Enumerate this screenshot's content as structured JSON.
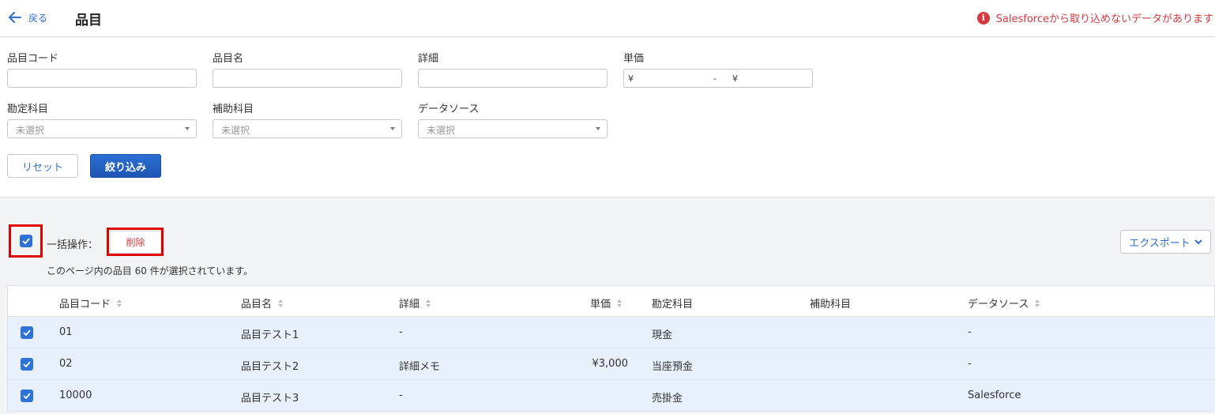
{
  "header": {
    "back_label": "戻る",
    "title": "品目",
    "warning": "Salesforceから取り込めないデータがあります"
  },
  "filters": {
    "code_label": "品目コード",
    "name_label": "品目名",
    "detail_label": "詳細",
    "price_label": "単価",
    "price_from_symbol": "¥",
    "price_separator": "-",
    "price_to_symbol": "¥",
    "account_label": "勘定科目",
    "sub_account_label": "補助科目",
    "source_label": "データソース",
    "account_value": "未選択",
    "sub_account_value": "未選択",
    "source_value": "未選択",
    "reset_label": "リセット",
    "apply_label": "絞り込み"
  },
  "bulk": {
    "label": "一括操作：",
    "delete_label": "削除",
    "export_label": "エクスポート",
    "selected_message": "このページ内の品目 60 件が選択されています。"
  },
  "table": {
    "columns": [
      "品目コード",
      "品目名",
      "詳細",
      "単価",
      "勘定科目",
      "補助科目",
      "データソース"
    ],
    "rows": [
      {
        "code": "01",
        "name": "品目テスト1",
        "detail": "-",
        "price": "",
        "account": "現金",
        "sub_account": "",
        "source": "-"
      },
      {
        "code": "02",
        "name": "品目テスト2",
        "detail": "詳細メモ",
        "price": "¥3,000",
        "account": "当座預金",
        "sub_account": "",
        "source": "-"
      },
      {
        "code": "10000",
        "name": "品目テスト3",
        "detail": "-",
        "price": "",
        "account": "売掛金",
        "sub_account": "",
        "source": "Salesforce"
      }
    ]
  },
  "colors": {
    "accent": "#2d72d9",
    "danger": "#d9363e",
    "highlight": "#e00000",
    "row_selected": "#e8f0fb"
  }
}
